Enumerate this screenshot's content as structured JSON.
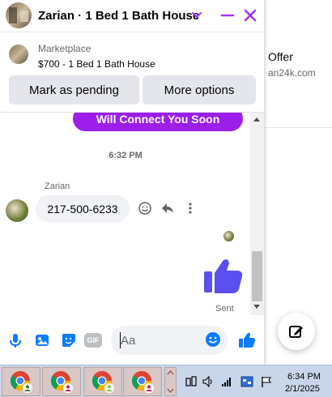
{
  "background": {
    "title": "Offer",
    "subtitle": "an24k.com"
  },
  "chat": {
    "header": {
      "title": "Zarian · 1 Bed 1 Bath House",
      "accent": "#a033ff"
    },
    "listing": {
      "source": "Marketplace",
      "title": "$700 - 1 Bed 1 Bath House"
    },
    "actions": {
      "mark_pending": "Mark as pending",
      "more_options": "More options"
    },
    "messages": {
      "outgoing_preview": "Will Connect You Soon",
      "timestamp": "6:32 PM",
      "sender_name": "Zarian",
      "incoming_text": "217-500-6233",
      "sent_label": "Sent"
    },
    "composer": {
      "placeholder": "Aa",
      "gif_label": "GIF"
    }
  },
  "taskbar": {
    "time": "6:34 PM",
    "date": "2/1/2025",
    "items": [
      {
        "icon": "chrome-icon",
        "profile_color": "#2e7d32"
      },
      {
        "icon": "chrome-icon",
        "profile_color": "#c2185b"
      },
      {
        "icon": "chrome-icon",
        "profile_color": "#8bc34a"
      },
      {
        "icon": "chrome-icon",
        "profile_color": "#c2185b"
      }
    ]
  },
  "colors": {
    "messenger_blue": "#0a7cff",
    "purple_bubble": "#9b1fe8",
    "header_purple": "#a033ff"
  }
}
